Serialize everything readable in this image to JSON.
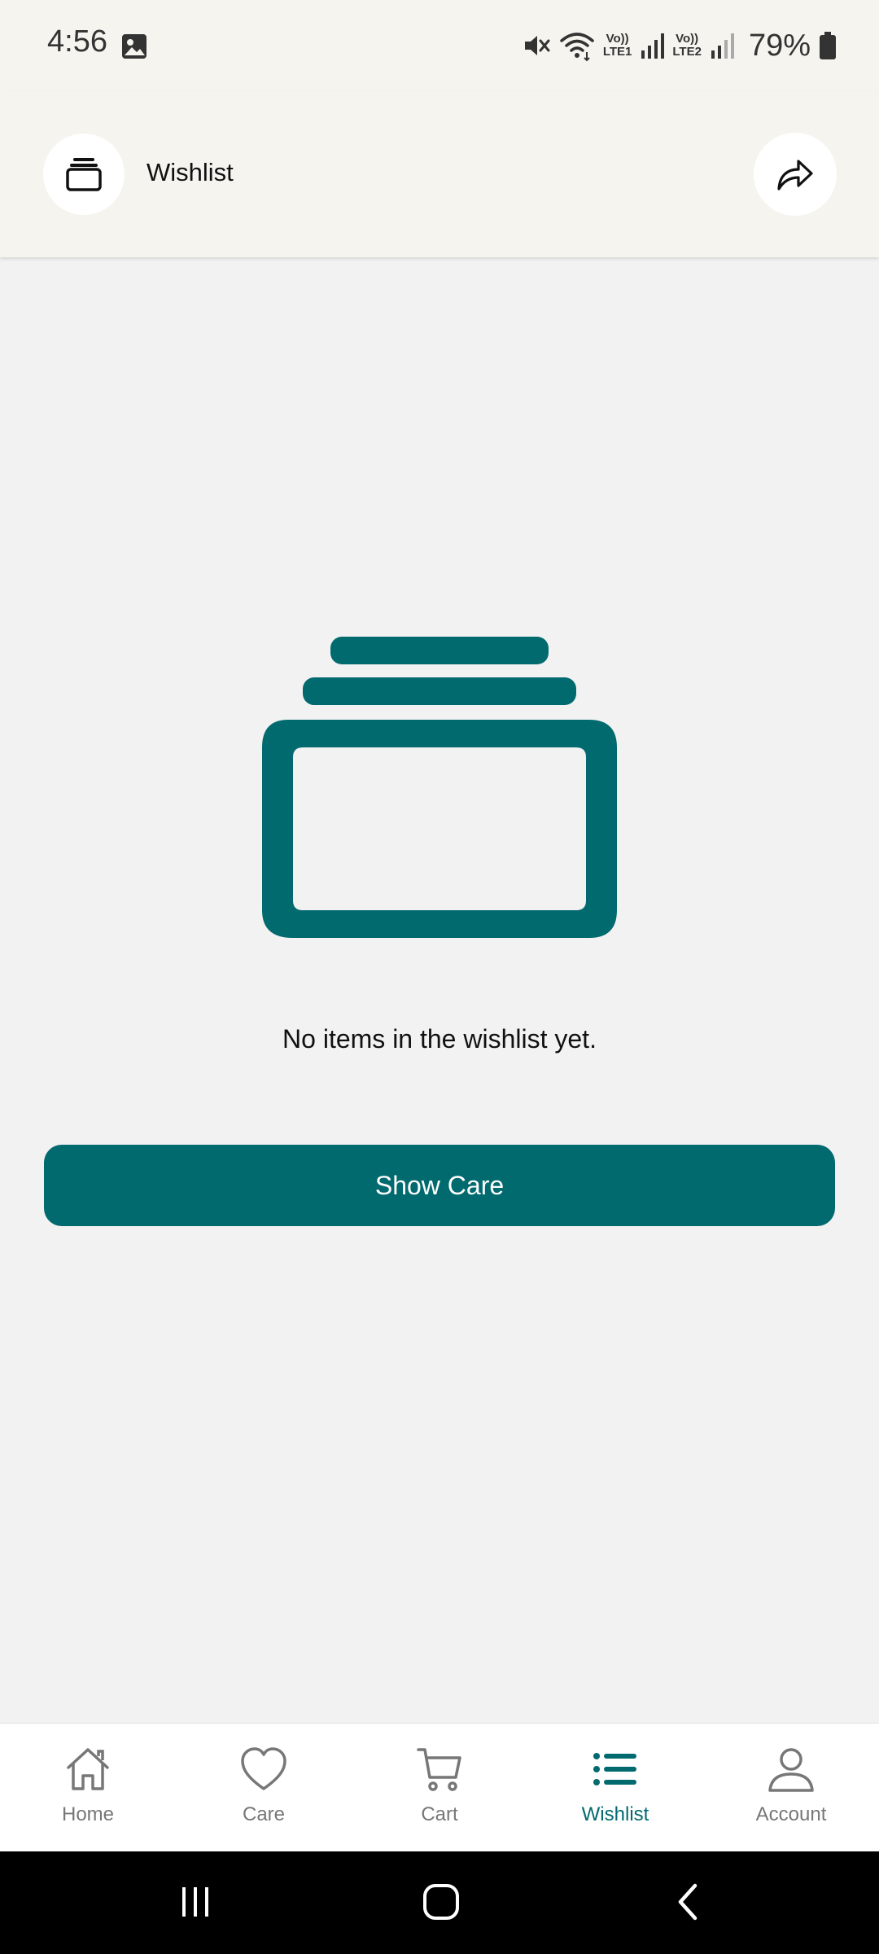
{
  "status_bar": {
    "time": "4:56",
    "battery": "79%",
    "sim1_label_top": "Vo))",
    "sim1_label_bottom": "LTE1",
    "sim2_label_top": "Vo))",
    "sim2_label_bottom": "LTE2",
    "icons": [
      "gallery-icon",
      "mute-icon",
      "wifi-icon",
      "signal-icon",
      "battery-icon"
    ]
  },
  "header": {
    "title": "Wishlist",
    "leading_icon": "wishlist-stack-icon",
    "share_icon": "share-icon"
  },
  "empty_state": {
    "illustration_icon": "wishlist-stack-icon",
    "message": "No items in the wishlist yet.",
    "button_label": "Show Care"
  },
  "bottom_nav": {
    "items": [
      {
        "label": "Home",
        "icon": "home-icon",
        "active": false
      },
      {
        "label": "Care",
        "icon": "heart-icon",
        "active": false
      },
      {
        "label": "Cart",
        "icon": "cart-icon",
        "active": false
      },
      {
        "label": "Wishlist",
        "icon": "list-icon",
        "active": true
      },
      {
        "label": "Account",
        "icon": "account-icon",
        "active": false
      }
    ]
  },
  "system_nav": {
    "icons": [
      "recent-apps-icon",
      "home-circle-icon",
      "back-icon"
    ]
  },
  "colors": {
    "accent": "#016a6f",
    "header_bg": "#f6f4ef",
    "page_bg": "#f2f2f2",
    "inactive_nav": "#777777"
  }
}
